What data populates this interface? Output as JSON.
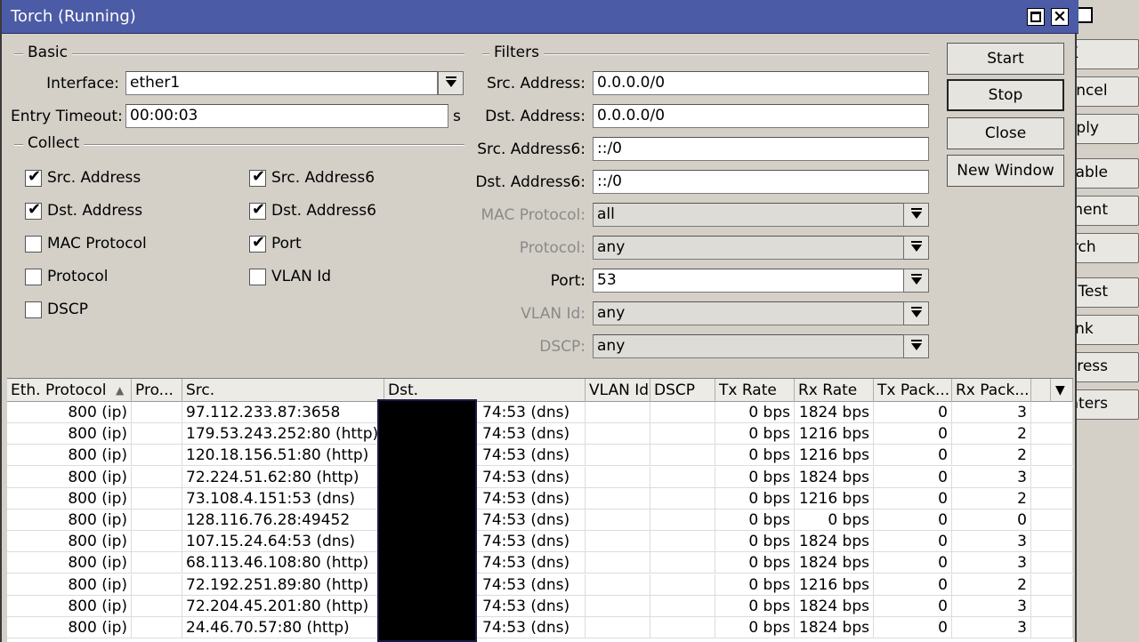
{
  "window": {
    "title": "Torch (Running)"
  },
  "background_window": {
    "buttons": [
      "OK",
      "Cancel",
      "Apply",
      "Disable",
      "Comment",
      "Torch",
      "Cable Test",
      "Blink",
      "Reset MAC Address",
      "Reset Counters"
    ]
  },
  "basic": {
    "heading": "Basic",
    "interface_label": "Interface:",
    "interface_value": "ether1",
    "timeout_label": "Entry Timeout:",
    "timeout_value": "00:00:03",
    "timeout_unit": "s"
  },
  "collect": {
    "heading": "Collect",
    "items": [
      {
        "label": "Src. Address",
        "checked": true
      },
      {
        "label": "Dst. Address",
        "checked": true
      },
      {
        "label": "MAC Protocol",
        "checked": false
      },
      {
        "label": "Protocol",
        "checked": false
      },
      {
        "label": "DSCP",
        "checked": false
      },
      {
        "label": "Src. Address6",
        "checked": true
      },
      {
        "label": "Dst. Address6",
        "checked": true
      },
      {
        "label": "Port",
        "checked": true
      },
      {
        "label": "VLAN Id",
        "checked": false
      }
    ]
  },
  "filters": {
    "heading": "Filters",
    "fields": [
      {
        "label": "Src. Address:",
        "value": "0.0.0.0/0",
        "enabled": true,
        "dropdown": false
      },
      {
        "label": "Dst. Address:",
        "value": "0.0.0.0/0",
        "enabled": true,
        "dropdown": false
      },
      {
        "label": "Src. Address6:",
        "value": "::/0",
        "enabled": true,
        "dropdown": false
      },
      {
        "label": "Dst. Address6:",
        "value": "::/0",
        "enabled": true,
        "dropdown": false
      },
      {
        "label": "MAC Protocol:",
        "value": "all",
        "enabled": false,
        "dropdown": true
      },
      {
        "label": "Protocol:",
        "value": "any",
        "enabled": false,
        "dropdown": true
      },
      {
        "label": "Port:",
        "value": "53",
        "enabled": true,
        "dropdown": true
      },
      {
        "label": "VLAN Id:",
        "value": "any",
        "enabled": false,
        "dropdown": true
      },
      {
        "label": "DSCP:",
        "value": "any",
        "enabled": false,
        "dropdown": true
      }
    ]
  },
  "buttons": {
    "start": "Start",
    "stop": "Stop",
    "close": "Close",
    "new_window": "New Window"
  },
  "table": {
    "columns": [
      "Eth. Protocol",
      "Pro...",
      "Src.",
      "Dst.",
      "VLAN Id",
      "DSCP",
      "Tx Rate",
      "Rx Rate",
      "Tx Pack...",
      "Rx Pack..."
    ],
    "sort_indicator": "▲",
    "rows": [
      {
        "eth": "800 (ip)",
        "proto": "",
        "src": "97.112.233.87:3658",
        "dst": "74:53 (dns)",
        "vlan": "",
        "dscp": "",
        "tx_rate": "0 bps",
        "rx_rate": "1824 bps",
        "tx_pack": "0",
        "rx_pack": "3"
      },
      {
        "eth": "800 (ip)",
        "proto": "",
        "src": "179.53.243.252:80 (http)",
        "dst": "74:53 (dns)",
        "vlan": "",
        "dscp": "",
        "tx_rate": "0 bps",
        "rx_rate": "1216 bps",
        "tx_pack": "0",
        "rx_pack": "2"
      },
      {
        "eth": "800 (ip)",
        "proto": "",
        "src": "120.18.156.51:80 (http)",
        "dst": "74:53 (dns)",
        "vlan": "",
        "dscp": "",
        "tx_rate": "0 bps",
        "rx_rate": "1216 bps",
        "tx_pack": "0",
        "rx_pack": "2"
      },
      {
        "eth": "800 (ip)",
        "proto": "",
        "src": "72.224.51.62:80 (http)",
        "dst": "74:53 (dns)",
        "vlan": "",
        "dscp": "",
        "tx_rate": "0 bps",
        "rx_rate": "1824 bps",
        "tx_pack": "0",
        "rx_pack": "3"
      },
      {
        "eth": "800 (ip)",
        "proto": "",
        "src": "73.108.4.151:53 (dns)",
        "dst": "74:53 (dns)",
        "vlan": "",
        "dscp": "",
        "tx_rate": "0 bps",
        "rx_rate": "1216 bps",
        "tx_pack": "0",
        "rx_pack": "2"
      },
      {
        "eth": "800 (ip)",
        "proto": "",
        "src": "128.116.76.28:49452",
        "dst": "74:53 (dns)",
        "vlan": "",
        "dscp": "",
        "tx_rate": "0 bps",
        "rx_rate": "0 bps",
        "tx_pack": "0",
        "rx_pack": "0"
      },
      {
        "eth": "800 (ip)",
        "proto": "",
        "src": "107.15.24.64:53 (dns)",
        "dst": "74:53 (dns)",
        "vlan": "",
        "dscp": "",
        "tx_rate": "0 bps",
        "rx_rate": "1824 bps",
        "tx_pack": "0",
        "rx_pack": "3"
      },
      {
        "eth": "800 (ip)",
        "proto": "",
        "src": "68.113.46.108:80 (http)",
        "dst": "74:53 (dns)",
        "vlan": "",
        "dscp": "",
        "tx_rate": "0 bps",
        "rx_rate": "1824 bps",
        "tx_pack": "0",
        "rx_pack": "3"
      },
      {
        "eth": "800 (ip)",
        "proto": "",
        "src": "72.192.251.89:80 (http)",
        "dst": "74:53 (dns)",
        "vlan": "",
        "dscp": "",
        "tx_rate": "0 bps",
        "rx_rate": "1216 bps",
        "tx_pack": "0",
        "rx_pack": "2"
      },
      {
        "eth": "800 (ip)",
        "proto": "",
        "src": "72.204.45.201:80 (http)",
        "dst": "74:53 (dns)",
        "vlan": "",
        "dscp": "",
        "tx_rate": "0 bps",
        "rx_rate": "1824 bps",
        "tx_pack": "0",
        "rx_pack": "3"
      },
      {
        "eth": "800 (ip)",
        "proto": "",
        "src": "24.46.70.57:80 (http)",
        "dst": "74:53 (dns)",
        "vlan": "",
        "dscp": "",
        "tx_rate": "0 bps",
        "rx_rate": "1824 bps",
        "tx_pack": "0",
        "rx_pack": "3"
      }
    ]
  },
  "icons": {
    "maximize": "maximize-icon",
    "close": "close-icon",
    "dropdown": "dropdown-arrow-icon",
    "checkmark": "✔",
    "column_menu": "▼"
  }
}
